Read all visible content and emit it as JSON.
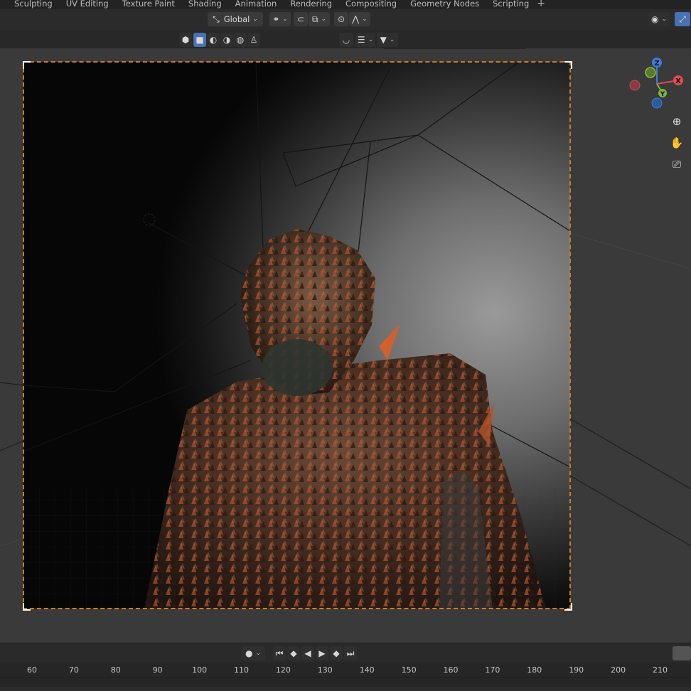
{
  "workspace_tabs": [
    "Sculpting",
    "UV Editing",
    "Texture Paint",
    "Shading",
    "Animation",
    "Rendering",
    "Compositing",
    "Geometry Nodes",
    "Scripting"
  ],
  "header": {
    "orientation_label": "Global"
  },
  "icons": {
    "transform_orientation": "orientation-axes-icon",
    "pivot": "pivot-link-icon",
    "snap": "magnet-icon",
    "proportional": "proportional-falloff-icon",
    "visibility": "eye-visibility-icon",
    "gizmo": "gizmo-toggle-icon",
    "search": "search-icon",
    "filter": "funnel-filter-icon",
    "zoom": "zoom-plus-icon",
    "pan": "hand-pan-icon",
    "camera": "camera-view-icon"
  },
  "nav_gizmo": {
    "x": "X",
    "y": "Y",
    "z": "Z"
  },
  "timeline": {
    "ticks": [
      "60",
      "70",
      "80",
      "90",
      "100",
      "110",
      "120",
      "130",
      "140",
      "150",
      "160",
      "170",
      "180",
      "190",
      "200",
      "210"
    ]
  },
  "colors": {
    "accent": "#4772b3",
    "camera_border": "#d07a2a",
    "axis_x": "#e04a55",
    "axis_y": "#7fb33d",
    "axis_z": "#3f7ed8"
  }
}
